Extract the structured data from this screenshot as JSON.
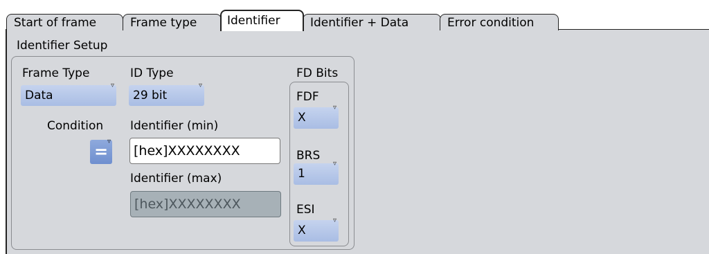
{
  "tabs": [
    {
      "label": "Start of frame",
      "active": false
    },
    {
      "label": "Frame type",
      "active": false
    },
    {
      "label": "Identifier",
      "active": true
    },
    {
      "label": "Identifier + Data",
      "active": false
    },
    {
      "label": "Error condition",
      "active": false
    }
  ],
  "section": {
    "title": "Identifier Setup"
  },
  "frame_type": {
    "label": "Frame Type",
    "value": "Data"
  },
  "id_type": {
    "label": "ID Type",
    "value": "29 bit"
  },
  "condition": {
    "label": "Condition",
    "value": "="
  },
  "identifier_min": {
    "label": "Identifier (min)",
    "value": "[hex]XXXXXXXX"
  },
  "identifier_max": {
    "label": "Identifier (max)",
    "value": "[hex]XXXXXXXX",
    "enabled": false
  },
  "fd_bits": {
    "title": "FD Bits",
    "fdf": {
      "label": "FDF",
      "value": "X"
    },
    "brs": {
      "label": "BRS",
      "value": "1"
    },
    "esi": {
      "label": "ESI",
      "value": "X"
    }
  },
  "icons": {
    "dropdown_arrow": "▿"
  },
  "colors": {
    "panel_bg": "#d6d8dc",
    "dropdown_bg": "#b3c5e8",
    "condition_button": "#7f9cd6",
    "disabled_field": "#a7b1b7"
  }
}
